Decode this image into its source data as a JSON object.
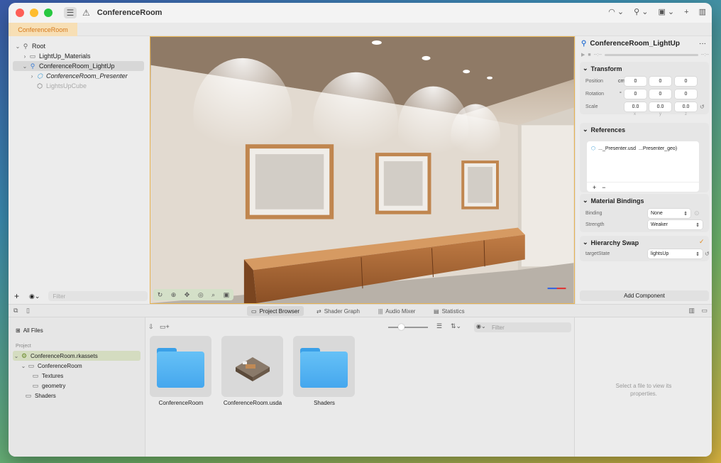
{
  "window": {
    "title": "ConferenceRoom",
    "doc_tab": "ConferenceRoom"
  },
  "outline": {
    "items": [
      {
        "label": "Root",
        "icon": "entity-icon"
      },
      {
        "label": "LightUp_Materials",
        "icon": "folder-icon"
      },
      {
        "label": "ConferenceRoom_LightUp",
        "icon": "entity-icon"
      },
      {
        "label": "ConferenceRoom_Presenter",
        "icon": "cube-icon"
      },
      {
        "label": "LightsUpCube",
        "icon": "cube-icon"
      }
    ],
    "filter_placeholder": "Filter"
  },
  "inspector": {
    "entity_name": "ConferenceRoom_LightUp",
    "transform": {
      "title": "Transform",
      "position_label": "Position",
      "position_unit": "cm",
      "position": [
        "0",
        "0",
        "0"
      ],
      "rotation_label": "Rotation",
      "rotation_unit": "°",
      "rotation": [
        "0",
        "0",
        "0"
      ],
      "scale_label": "Scale",
      "scale": [
        "0.0",
        "0.0",
        "0.0"
      ],
      "axes": [
        "x",
        "y",
        "z"
      ]
    },
    "references": {
      "title": "References",
      "item_file": "..._Presenter.usd",
      "item_prim": "...Presenter_geo)",
      "add": "+",
      "remove": "−"
    },
    "material_bindings": {
      "title": "Material Bindings",
      "binding_label": "Binding",
      "binding_value": "None",
      "strength_label": "Strength",
      "strength_value": "Weaker"
    },
    "hierarchy_swap": {
      "title": "Hierarchy Swap",
      "target_label": "targetState",
      "target_value": "lightsUp"
    },
    "add_component": "Add Component"
  },
  "bottom_tabs": [
    {
      "label": "Project Browser",
      "icon": "folder-icon"
    },
    {
      "label": "Shader Graph",
      "icon": "graph-icon"
    },
    {
      "label": "Audio Mixer",
      "icon": "audio-icon"
    },
    {
      "label": "Statistics",
      "icon": "chart-icon"
    }
  ],
  "project_sidebar": {
    "all_files": "All Files",
    "project_header": "Project",
    "items": [
      {
        "label": "ConferenceRoom.rkassets"
      },
      {
        "label": "ConferenceRoom"
      },
      {
        "label": "Textures"
      },
      {
        "label": "geometry"
      },
      {
        "label": "Shaders"
      }
    ]
  },
  "browser": {
    "filter_placeholder": "Filter",
    "files": [
      {
        "name": "ConferenceRoom",
        "kind": "folder"
      },
      {
        "name": "ConferenceRoom.usda",
        "kind": "usda"
      },
      {
        "name": "Shaders",
        "kind": "folder"
      }
    ]
  },
  "properties": {
    "empty_message": "Select a file to view its properties."
  },
  "colors": {
    "accent": "#e8b350",
    "doc_tab_text": "#d6791b",
    "folder_blue": "#45a7ee",
    "selected_row": "#d4dcc0"
  }
}
